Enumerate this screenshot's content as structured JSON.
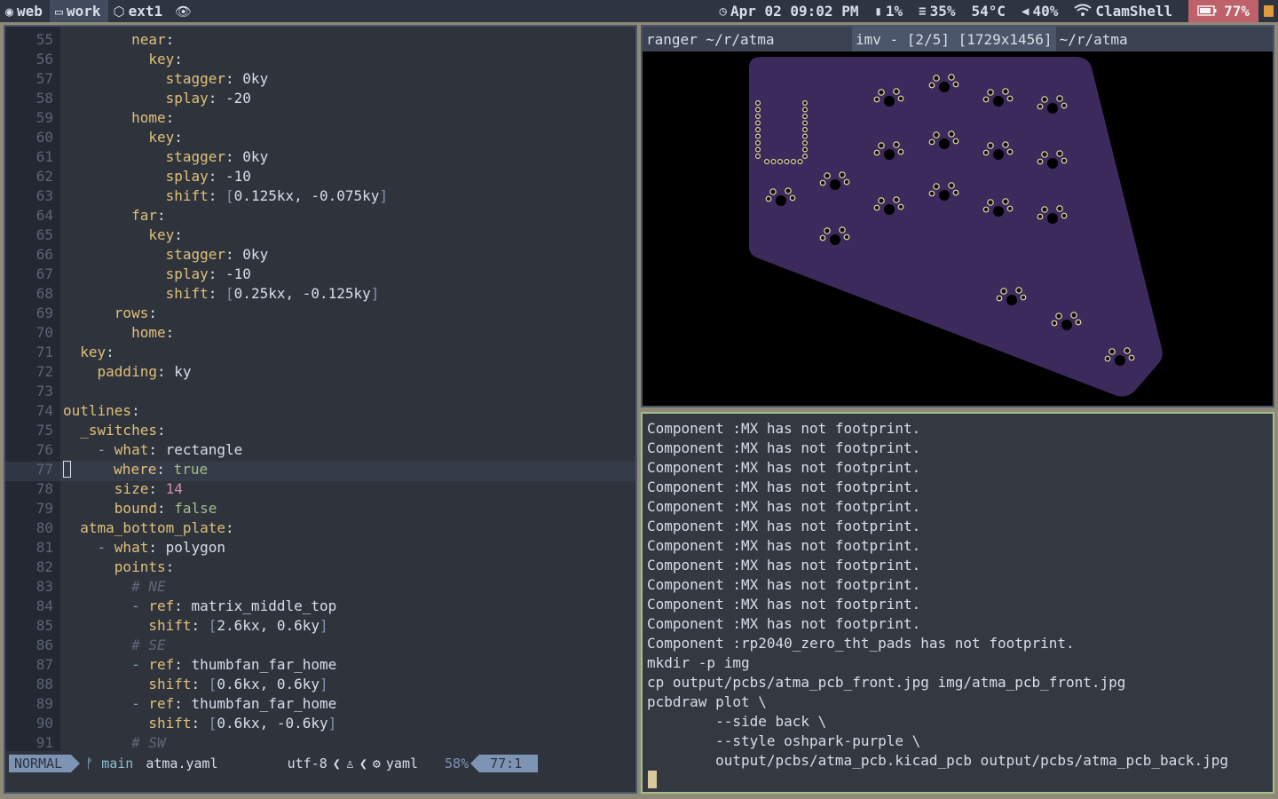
{
  "topbar": {
    "workspaces": [
      {
        "label": "web",
        "icon": "chrome-icon",
        "active": false
      },
      {
        "label": "work",
        "icon": "monitor-icon",
        "active": true
      },
      {
        "label": "ext1",
        "icon": "cube-icon",
        "active": false
      },
      {
        "label": "",
        "icon": "eye-icon",
        "active": false
      }
    ],
    "clock": "Apr 02 09:02 PM",
    "disk": "1%",
    "memory": "35%",
    "temperature": "54°C",
    "volume": "40%",
    "wifi": "ClamShell",
    "battery": "77%"
  },
  "editor": {
    "lines": [
      {
        "n": "55",
        "segs": [
          [
            "i",
            "        "
          ],
          [
            "k",
            "near"
          ],
          [
            "v",
            ":"
          ]
        ]
      },
      {
        "n": "56",
        "segs": [
          [
            "i",
            "          "
          ],
          [
            "k",
            "key"
          ],
          [
            "v",
            ":"
          ]
        ]
      },
      {
        "n": "57",
        "segs": [
          [
            "i",
            "            "
          ],
          [
            "k",
            "stagger"
          ],
          [
            "v",
            ": 0ky"
          ]
        ]
      },
      {
        "n": "58",
        "segs": [
          [
            "i",
            "            "
          ],
          [
            "k",
            "splay"
          ],
          [
            "v",
            ": -20"
          ]
        ]
      },
      {
        "n": "59",
        "segs": [
          [
            "i",
            "        "
          ],
          [
            "k",
            "home"
          ],
          [
            "v",
            ":"
          ]
        ]
      },
      {
        "n": "60",
        "segs": [
          [
            "i",
            "          "
          ],
          [
            "k",
            "key"
          ],
          [
            "v",
            ":"
          ]
        ]
      },
      {
        "n": "61",
        "segs": [
          [
            "i",
            "            "
          ],
          [
            "k",
            "stagger"
          ],
          [
            "v",
            ": 0ky"
          ]
        ]
      },
      {
        "n": "62",
        "segs": [
          [
            "i",
            "            "
          ],
          [
            "k",
            "splay"
          ],
          [
            "v",
            ": -10"
          ]
        ]
      },
      {
        "n": "63",
        "segs": [
          [
            "i",
            "            "
          ],
          [
            "k",
            "shift"
          ],
          [
            "v",
            ": "
          ],
          [
            "b",
            "["
          ],
          [
            "v",
            "0.125kx, -0.075ky"
          ],
          [
            "b",
            "]"
          ]
        ]
      },
      {
        "n": "64",
        "segs": [
          [
            "i",
            "        "
          ],
          [
            "k",
            "far"
          ],
          [
            "v",
            ":"
          ]
        ]
      },
      {
        "n": "65",
        "segs": [
          [
            "i",
            "          "
          ],
          [
            "k",
            "key"
          ],
          [
            "v",
            ":"
          ]
        ]
      },
      {
        "n": "66",
        "segs": [
          [
            "i",
            "            "
          ],
          [
            "k",
            "stagger"
          ],
          [
            "v",
            ": 0ky"
          ]
        ]
      },
      {
        "n": "67",
        "segs": [
          [
            "i",
            "            "
          ],
          [
            "k",
            "splay"
          ],
          [
            "v",
            ": -10"
          ]
        ]
      },
      {
        "n": "68",
        "segs": [
          [
            "i",
            "            "
          ],
          [
            "k",
            "shift"
          ],
          [
            "v",
            ": "
          ],
          [
            "b",
            "["
          ],
          [
            "v",
            "0.25kx, -0.125ky"
          ],
          [
            "b",
            "]"
          ]
        ]
      },
      {
        "n": "69",
        "segs": [
          [
            "i",
            "      "
          ],
          [
            "k",
            "rows"
          ],
          [
            "v",
            ":"
          ]
        ]
      },
      {
        "n": "70",
        "segs": [
          [
            "i",
            "        "
          ],
          [
            "k",
            "home"
          ],
          [
            "v",
            ":"
          ]
        ]
      },
      {
        "n": "71",
        "segs": [
          [
            "i",
            "  "
          ],
          [
            "k",
            "key"
          ],
          [
            "v",
            ":"
          ]
        ]
      },
      {
        "n": "72",
        "segs": [
          [
            "i",
            "    "
          ],
          [
            "k",
            "padding"
          ],
          [
            "v",
            ": ky"
          ]
        ]
      },
      {
        "n": "73",
        "segs": []
      },
      {
        "n": "74",
        "segs": [
          [
            "k",
            "outlines"
          ],
          [
            "v",
            ":"
          ]
        ]
      },
      {
        "n": "75",
        "segs": [
          [
            "i",
            "  "
          ],
          [
            "k",
            "_switches"
          ],
          [
            "v",
            ":"
          ]
        ]
      },
      {
        "n": "76",
        "segs": [
          [
            "i",
            "    "
          ],
          [
            "bul",
            "- "
          ],
          [
            "k",
            "what"
          ],
          [
            "v",
            ": rectangle"
          ]
        ]
      },
      {
        "n": "77",
        "segs": [
          [
            "cur",
            ""
          ],
          [
            "i",
            "     "
          ],
          [
            "k",
            "where"
          ],
          [
            "v",
            ": "
          ],
          [
            "s",
            "true"
          ]
        ]
      },
      {
        "n": "78",
        "segs": [
          [
            "i",
            "      "
          ],
          [
            "k",
            "size"
          ],
          [
            "v",
            ": "
          ],
          [
            "num",
            "14"
          ]
        ]
      },
      {
        "n": "79",
        "segs": [
          [
            "i",
            "      "
          ],
          [
            "k",
            "bound"
          ],
          [
            "v",
            ": "
          ],
          [
            "s",
            "false"
          ]
        ]
      },
      {
        "n": "80",
        "segs": [
          [
            "i",
            "  "
          ],
          [
            "k",
            "atma_bottom_plate"
          ],
          [
            "v",
            ":"
          ]
        ]
      },
      {
        "n": "81",
        "segs": [
          [
            "i",
            "    "
          ],
          [
            "bul",
            "- "
          ],
          [
            "k",
            "what"
          ],
          [
            "v",
            ": polygon"
          ]
        ]
      },
      {
        "n": "82",
        "segs": [
          [
            "i",
            "      "
          ],
          [
            "k",
            "points"
          ],
          [
            "v",
            ":"
          ]
        ]
      },
      {
        "n": "83",
        "segs": [
          [
            "i",
            "        "
          ],
          [
            "cm",
            "# NE"
          ]
        ]
      },
      {
        "n": "84",
        "segs": [
          [
            "i",
            "        "
          ],
          [
            "bul",
            "- "
          ],
          [
            "k",
            "ref"
          ],
          [
            "v",
            ": matrix_middle_top"
          ]
        ]
      },
      {
        "n": "85",
        "segs": [
          [
            "i",
            "          "
          ],
          [
            "k",
            "shift"
          ],
          [
            "v",
            ": "
          ],
          [
            "b",
            "["
          ],
          [
            "v",
            "2.6kx, 0.6ky"
          ],
          [
            "b",
            "]"
          ]
        ]
      },
      {
        "n": "86",
        "segs": [
          [
            "i",
            "        "
          ],
          [
            "cm",
            "# SE"
          ]
        ]
      },
      {
        "n": "87",
        "segs": [
          [
            "i",
            "        "
          ],
          [
            "bul",
            "- "
          ],
          [
            "k",
            "ref"
          ],
          [
            "v",
            ": thumbfan_far_home"
          ]
        ]
      },
      {
        "n": "88",
        "segs": [
          [
            "i",
            "          "
          ],
          [
            "k",
            "shift"
          ],
          [
            "v",
            ": "
          ],
          [
            "b",
            "["
          ],
          [
            "v",
            "0.6kx, 0.6ky"
          ],
          [
            "b",
            "]"
          ]
        ]
      },
      {
        "n": "89",
        "segs": [
          [
            "i",
            "        "
          ],
          [
            "bul",
            "- "
          ],
          [
            "k",
            "ref"
          ],
          [
            "v",
            ": thumbfan_far_home"
          ]
        ]
      },
      {
        "n": "90",
        "segs": [
          [
            "i",
            "          "
          ],
          [
            "k",
            "shift"
          ],
          [
            "v",
            ": "
          ],
          [
            "b",
            "["
          ],
          [
            "v",
            "0.6kx, -0.6ky"
          ],
          [
            "b",
            "]"
          ]
        ]
      },
      {
        "n": "91",
        "segs": [
          [
            "i",
            "        "
          ],
          [
            "cm",
            "# SW"
          ]
        ]
      }
    ],
    "status": {
      "mode": "NORMAL",
      "branch": "main",
      "branch_icon": "git-branch-icon",
      "file": "atma.yaml",
      "encoding": "utf-8",
      "os_icon": "linux-icon",
      "filetype_icon": "gear-icon",
      "filetype": "yaml",
      "percent": "58%",
      "position": "77:1"
    }
  },
  "viewer": {
    "tabs": [
      "ranger ~/r/atma",
      "imv - [2/5] [1729x1456]",
      "~/r/atma"
    ],
    "active_tab": 1,
    "board_color": "#3c2a5c"
  },
  "terminal": {
    "lines": [
      "Component :MX has not footprint.",
      "Component :MX has not footprint.",
      "Component :MX has not footprint.",
      "Component :MX has not footprint.",
      "Component :MX has not footprint.",
      "Component :MX has not footprint.",
      "Component :MX has not footprint.",
      "Component :MX has not footprint.",
      "Component :MX has not footprint.",
      "Component :MX has not footprint.",
      "Component :MX has not footprint.",
      "Component :rp2040_zero_tht_pads has not footprint.",
      "mkdir -p img",
      "cp output/pcbs/atma_pcb_front.jpg img/atma_pcb_front.jpg",
      "pcbdraw plot \\",
      "        --side back \\",
      "        --style oshpark-purple \\",
      "        output/pcbs/atma_pcb.kicad_pcb output/pcbs/atma_pcb_back.jpg"
    ]
  }
}
